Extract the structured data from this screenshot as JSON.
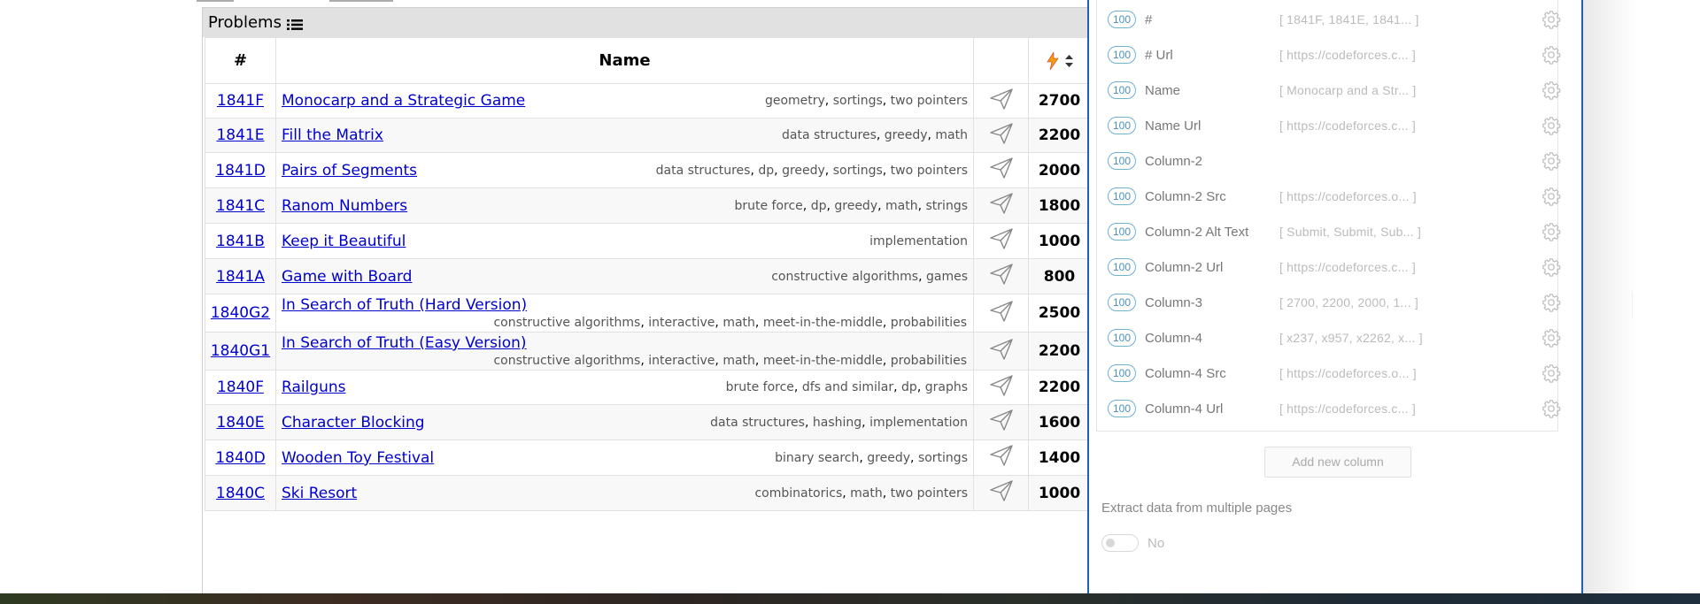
{
  "problems": {
    "title": "Problems",
    "headers": {
      "id": "#",
      "name": "Name"
    },
    "rows": [
      {
        "id": "1841F",
        "name": "Monocarp and a Strategic Game",
        "tags": [
          "geometry",
          "sortings",
          "two pointers"
        ],
        "rating": "2700"
      },
      {
        "id": "1841E",
        "name": "Fill the Matrix",
        "tags": [
          "data structures",
          "greedy",
          "math"
        ],
        "rating": "2200"
      },
      {
        "id": "1841D",
        "name": "Pairs of Segments",
        "tags": [
          "data structures",
          "dp",
          "greedy",
          "sortings",
          "two pointers"
        ],
        "rating": "2000"
      },
      {
        "id": "1841C",
        "name": "Ranom Numbers",
        "tags": [
          "brute force",
          "dp",
          "greedy",
          "math",
          "strings"
        ],
        "rating": "1800"
      },
      {
        "id": "1841B",
        "name": "Keep it Beautiful",
        "tags": [
          "implementation"
        ],
        "rating": "1000"
      },
      {
        "id": "1841A",
        "name": "Game with Board",
        "tags": [
          "constructive algorithms",
          "games"
        ],
        "rating": "800"
      },
      {
        "id": "1840G2",
        "name": "In Search of Truth (Hard Version)",
        "tags": [
          "constructive algorithms",
          "interactive",
          "math",
          "meet-in-the-middle",
          "probabilities"
        ],
        "rating": "2500",
        "double": true
      },
      {
        "id": "1840G1",
        "name": "In Search of Truth (Easy Version)",
        "tags": [
          "constructive algorithms",
          "interactive",
          "math",
          "meet-in-the-middle",
          "probabilities"
        ],
        "rating": "2200",
        "double": true
      },
      {
        "id": "1840F",
        "name": "Railguns",
        "tags": [
          "brute force",
          "dfs and similar",
          "dp",
          "graphs"
        ],
        "rating": "2200"
      },
      {
        "id": "1840E",
        "name": "Character Blocking",
        "tags": [
          "data structures",
          "hashing",
          "implementation"
        ],
        "rating": "1600"
      },
      {
        "id": "1840D",
        "name": "Wooden Toy Festival",
        "tags": [
          "binary search",
          "greedy",
          "sortings"
        ],
        "rating": "1400"
      },
      {
        "id": "1840C",
        "name": "Ski Resort",
        "tags": [
          "combinatorics",
          "math",
          "two pointers"
        ],
        "rating": "1000"
      }
    ]
  },
  "scraper": {
    "columns": [
      {
        "pct": "100",
        "name": "#",
        "sample": "[ 1841F, 1841E, 1841... ]"
      },
      {
        "pct": "100",
        "name": "# Url",
        "sample": "[ https://codeforces.c... ]"
      },
      {
        "pct": "100",
        "name": "Name",
        "sample": "[ Monocarp and a Str... ]"
      },
      {
        "pct": "100",
        "name": "Name Url",
        "sample": "[ https://codeforces.c... ]"
      },
      {
        "pct": "100",
        "name": "Column-2",
        "sample": ""
      },
      {
        "pct": "100",
        "name": "Column-2 Src",
        "sample": "[ https://codeforces.o... ]"
      },
      {
        "pct": "100",
        "name": "Column-2 Alt Text",
        "sample": "[ Submit, Submit, Sub... ]"
      },
      {
        "pct": "100",
        "name": "Column-2 Url",
        "sample": "[ https://codeforces.c... ]"
      },
      {
        "pct": "100",
        "name": "Column-3",
        "sample": "[ 2700, 2200, 2000, 1... ]"
      },
      {
        "pct": "100",
        "name": "Column-4",
        "sample": "[ x237, x957, x2262, x... ]"
      },
      {
        "pct": "100",
        "name": "Column-4 Src",
        "sample": "[ https://codeforces.o... ]"
      },
      {
        "pct": "100",
        "name": "Column-4 Url",
        "sample": "[ https://codeforces.c... ]"
      }
    ],
    "add_column_label": "Add new column",
    "multi_page_label": "Extract data from multiple pages",
    "multi_page_value": "No"
  },
  "colors": {
    "link": "#0000cc",
    "badge": "#6fb3d6",
    "accent": "#1f5fb4",
    "bolt": "#f39c12"
  }
}
